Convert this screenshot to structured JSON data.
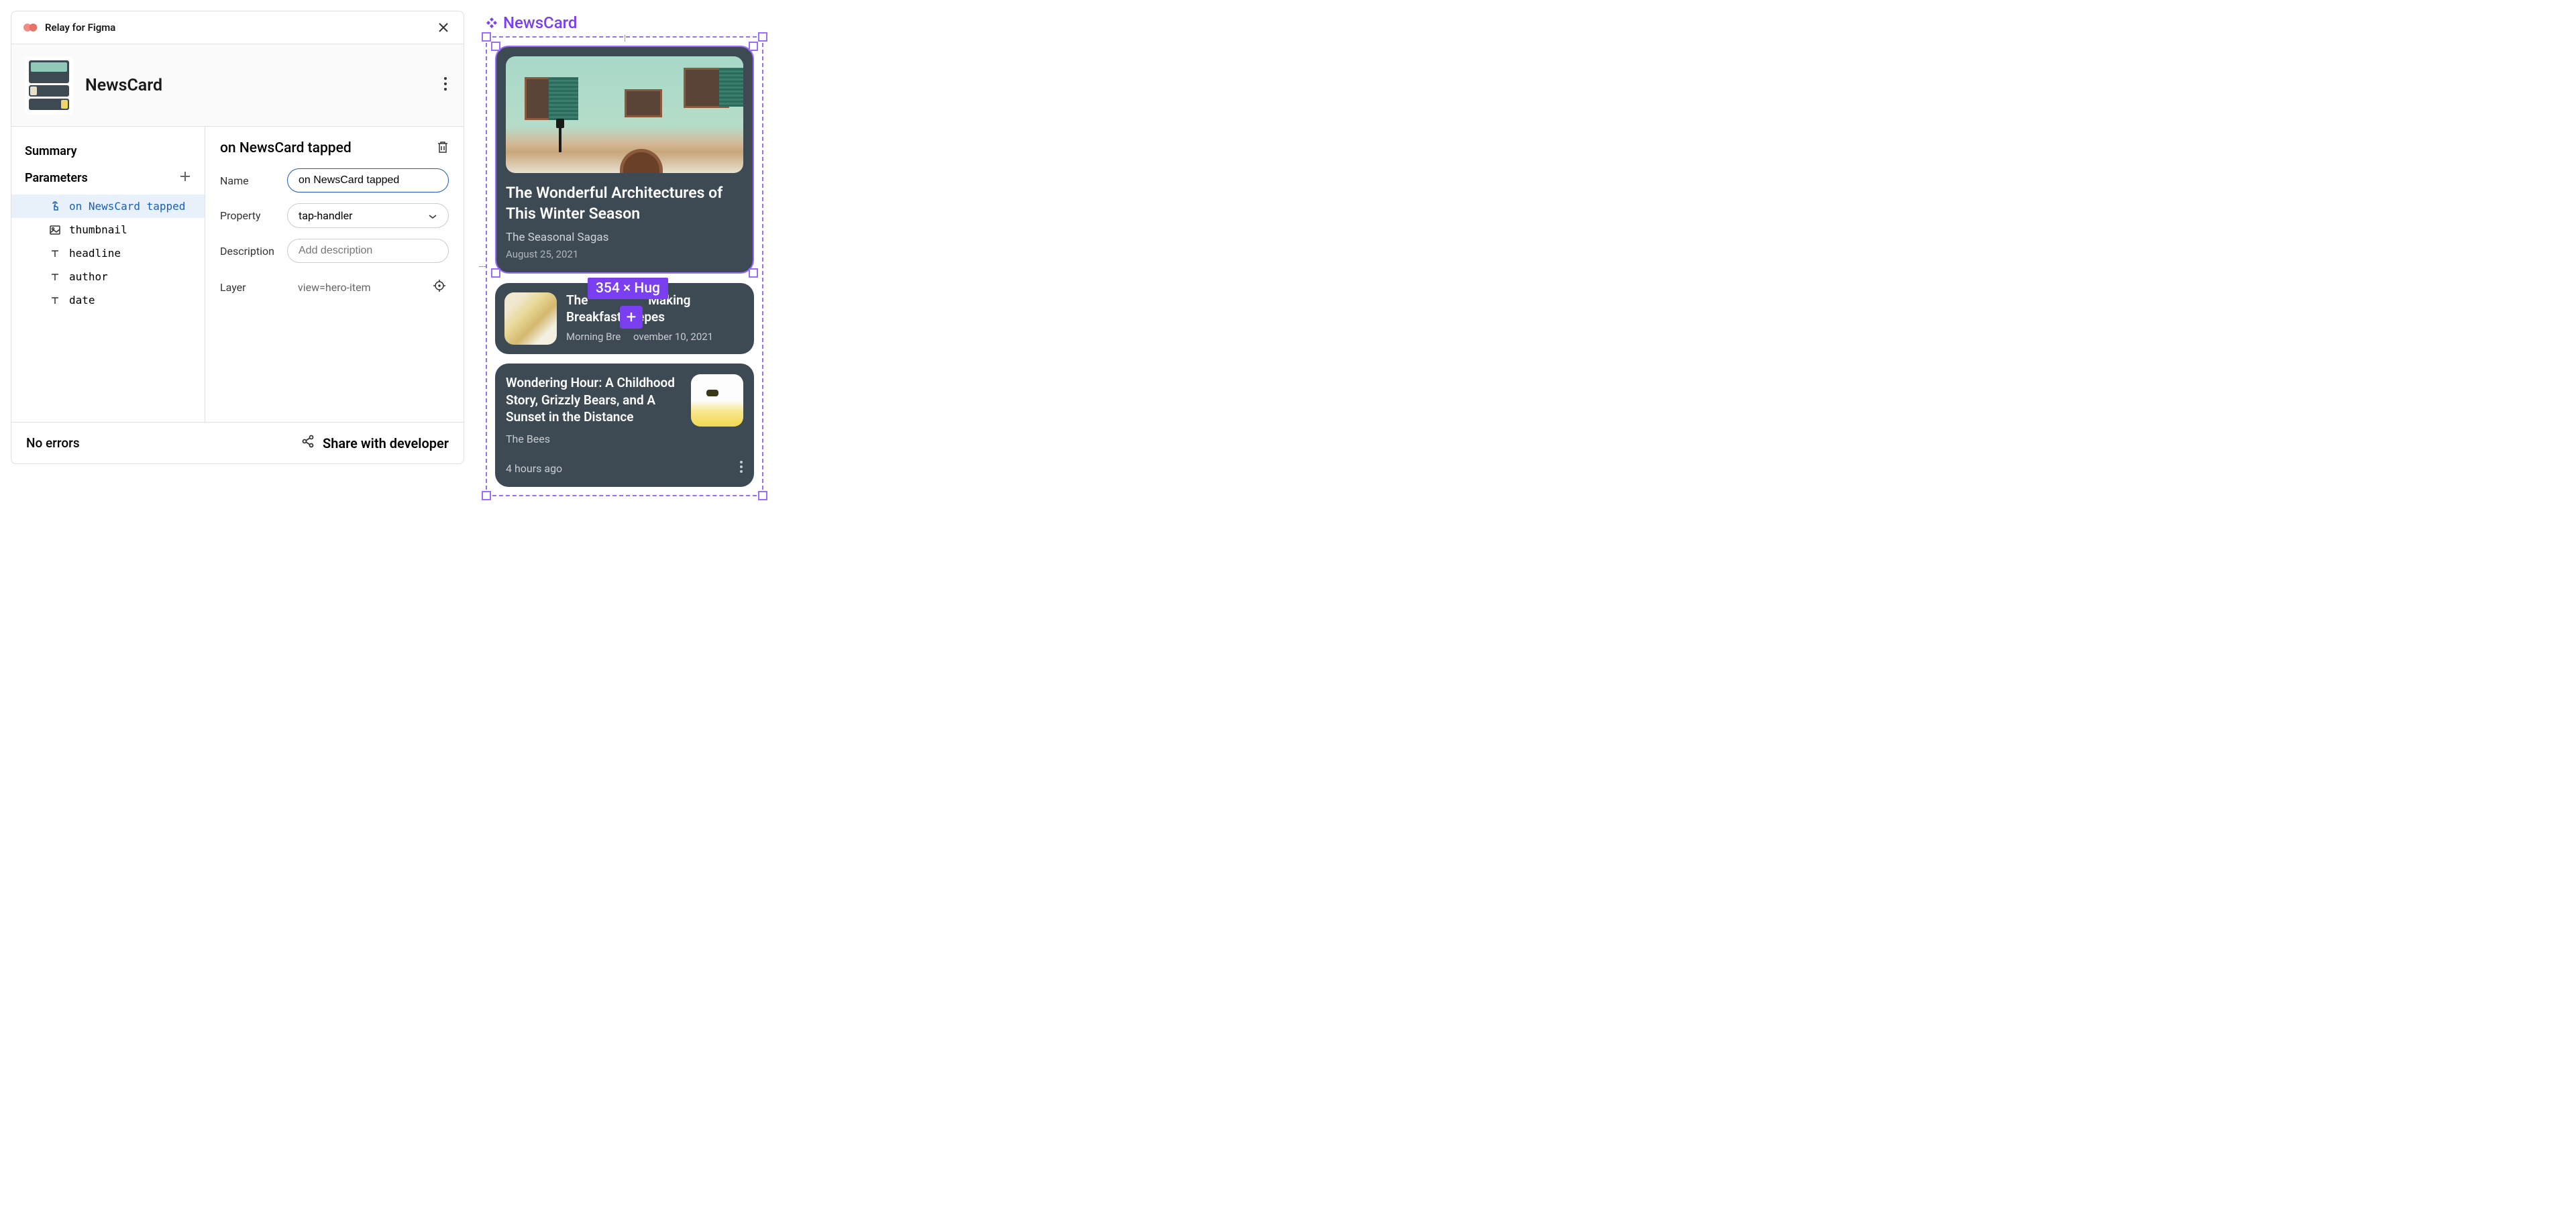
{
  "plugin": {
    "title": "Relay for Figma",
    "component_name": "NewsCard",
    "summary_label": "Summary",
    "parameters_label": "Parameters",
    "parameters": [
      {
        "name": "on NewsCard tapped",
        "icon": "tap"
      },
      {
        "name": "thumbnail",
        "icon": "image"
      },
      {
        "name": "headline",
        "icon": "text"
      },
      {
        "name": "author",
        "icon": "text"
      },
      {
        "name": "date",
        "icon": "text"
      }
    ],
    "selected_param": "on NewsCard tapped",
    "detail": {
      "title": "on NewsCard tapped",
      "name_label": "Name",
      "name_value": "on NewsCard tapped",
      "property_label": "Property",
      "property_value": "tap-handler",
      "description_label": "Description",
      "description_placeholder": "Add description",
      "layer_label": "Layer",
      "layer_value": "view=hero-item"
    },
    "errors_text": "No errors",
    "share_label": "Share with developer"
  },
  "canvas": {
    "component_label": "NewsCard",
    "size_badge": "354 × Hug",
    "hero": {
      "headline": "The Wonderful Architectures of This Winter Season",
      "author": "The Seasonal Sagas",
      "date": "August 25, 2021"
    },
    "row1": {
      "headline_prefix": "The",
      "headline_mid": "Making",
      "headline_line2": "Breakfast Crepes",
      "author": "Morning Bre",
      "date_fragment": "ovember 10, 2021"
    },
    "card3": {
      "headline": "Wondering Hour: A Childhood Story, Grizzly Bears, and A Sunset in the Distance",
      "author": "The Bees",
      "time": "4 hours ago"
    }
  }
}
